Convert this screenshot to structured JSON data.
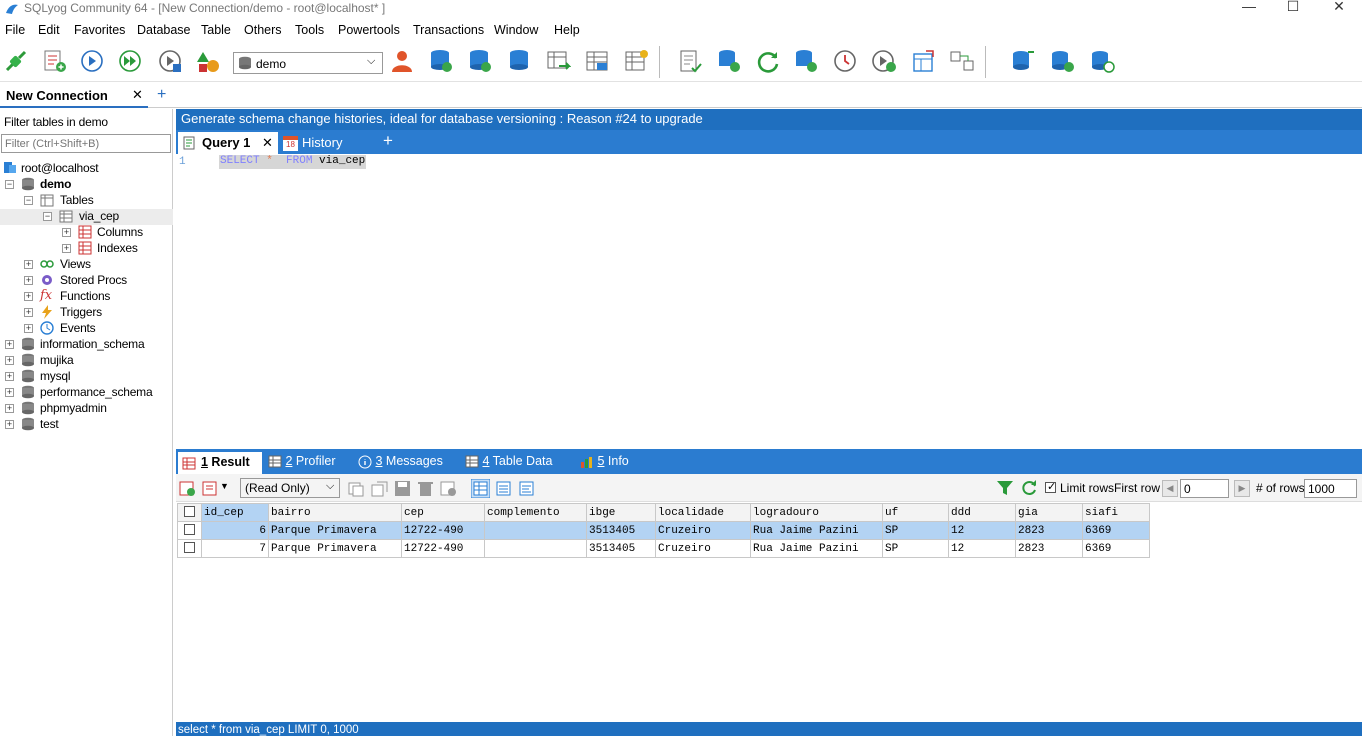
{
  "window": {
    "title": "SQLyog Community 64 - [New Connection/demo - root@localhost* ]"
  },
  "menu": [
    "File",
    "Edit",
    "Favorites",
    "Database",
    "Table",
    "Others",
    "Tools",
    "Powertools",
    "Transactions",
    "Window",
    "Help"
  ],
  "toolbar": {
    "database_select": "demo"
  },
  "connection_tab": {
    "label": "New Connection",
    "add": "+"
  },
  "left": {
    "filter_label": "Filter tables in demo",
    "filter_placeholder": "Filter (Ctrl+Shift+B)",
    "root": "root@localhost",
    "db": "demo",
    "tables": "Tables",
    "table": "via_cep",
    "columns": "Columns",
    "indexes": "Indexes",
    "views": "Views",
    "procs": "Stored Procs",
    "functions": "Functions",
    "triggers": "Triggers",
    "events": "Events",
    "other_dbs": [
      "information_schema",
      "mujika",
      "mysql",
      "performance_schema",
      "phpmyadmin",
      "test"
    ]
  },
  "banner": "Generate schema change histories, ideal for database versioning : Reason #24 to upgrade",
  "query_tabs": {
    "query": "Query 1",
    "history": "History",
    "history_day": "18",
    "add": "+"
  },
  "editor": {
    "line_no": "1",
    "kw1": "SELECT",
    "star": "*",
    "kw2": "FROM",
    "table": "via_cep"
  },
  "result_tabs": [
    {
      "num": "1",
      "label": " Result"
    },
    {
      "num": "2",
      "label": " Profiler"
    },
    {
      "num": "3",
      "label": " Messages"
    },
    {
      "num": "4",
      "label": " Table Data"
    },
    {
      "num": "5",
      "label": " Info"
    }
  ],
  "result_toolbar": {
    "mode": "(Read Only)",
    "limit_rows": "Limit rows",
    "first_row_label": "First row",
    "first_row": "0",
    "num_rows_label": "# of rows",
    "num_rows": "1000"
  },
  "grid": {
    "columns": [
      "id_cep",
      "bairro",
      "cep",
      "complemento",
      "ibge",
      "localidade",
      "logradouro",
      "uf",
      "ddd",
      "gia",
      "siafi"
    ],
    "rows": [
      [
        "6",
        "Parque Primavera",
        "12722-490",
        "",
        "3513405",
        "Cruzeiro",
        "Rua Jaime Pazini",
        "SP",
        "12",
        "2823",
        "6369"
      ],
      [
        "7",
        "Parque Primavera",
        "12722-490",
        "",
        "3513405",
        "Cruzeiro",
        "Rua Jaime Pazini",
        "SP",
        "12",
        "2823",
        "6369"
      ]
    ]
  },
  "status": "select * from via_cep LIMIT 0, 1000",
  "colors": {
    "accent_blue": "#1f6fbf",
    "tab_blue": "#2b7cd0",
    "selected_row": "#b3d3f3",
    "keyword": "#8080ff"
  }
}
